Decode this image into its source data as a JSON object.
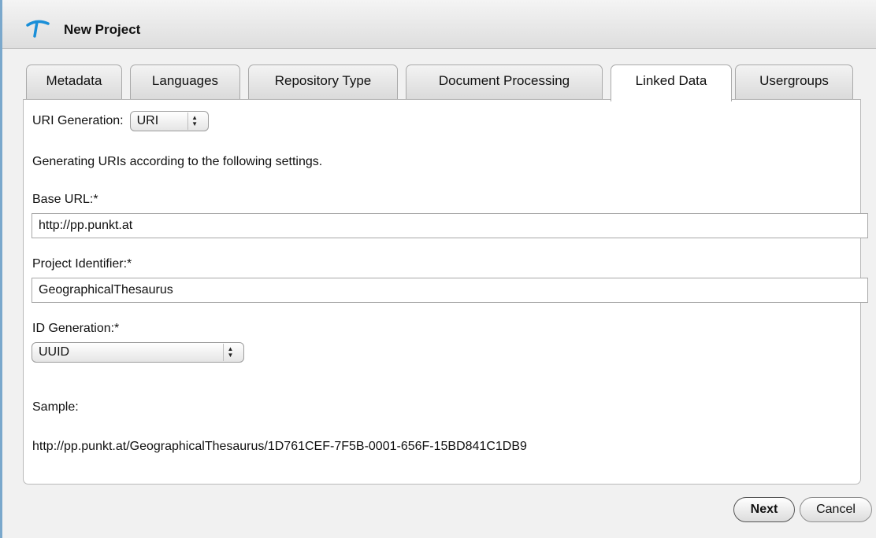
{
  "window": {
    "title": "New Project"
  },
  "tabs": [
    {
      "label": "Metadata"
    },
    {
      "label": "Languages"
    },
    {
      "label": "Repository Type"
    },
    {
      "label": "Document Processing"
    },
    {
      "label": "Linked Data",
      "active": true
    },
    {
      "label": "Usergroups"
    }
  ],
  "uri_generation": {
    "label": "URI Generation:",
    "selected": "URI"
  },
  "info_text": "Generating URIs according to the following settings.",
  "base_url": {
    "label": "Base URL:*",
    "value": "http://pp.punkt.at"
  },
  "project_identifier": {
    "label": "Project Identifier:*",
    "value": "GeographicalThesaurus"
  },
  "id_generation": {
    "label": "ID Generation:*",
    "selected": "UUID"
  },
  "sample": {
    "label": "Sample:",
    "value": "http://pp.punkt.at/GeographicalThesaurus/1D761CEF-7F5B-0001-656F-15BD841C1DB9"
  },
  "buttons": {
    "next": "Next",
    "cancel": "Cancel"
  },
  "colors": {
    "accent_border": "#7aa8cc",
    "icon_blue": "#1a8fd8"
  },
  "icons": {
    "app": "app-logo-icon",
    "stepper": "up-down-stepper-icon"
  }
}
